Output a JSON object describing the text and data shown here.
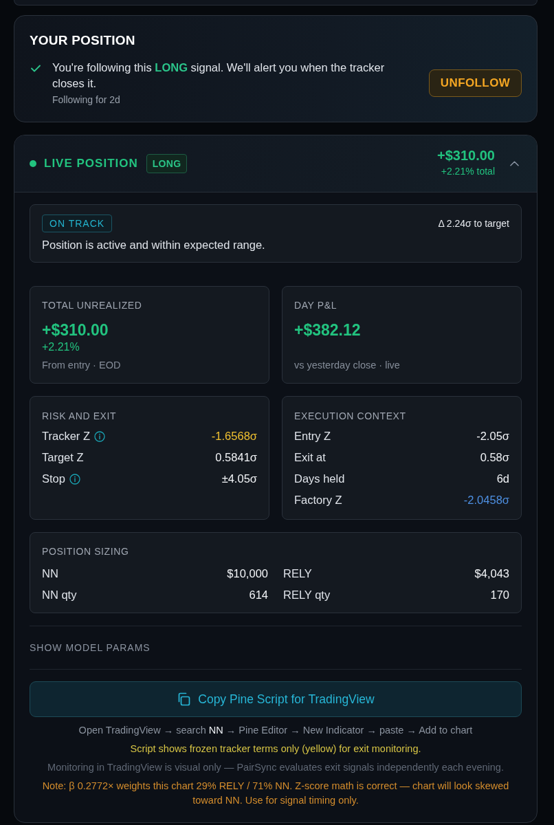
{
  "your_position": {
    "title": "YOUR POSITION",
    "following": true,
    "message": "You're following this **LONG** signal. We'll alert you when the tracker closes it.",
    "duration": "Following for 2d",
    "button": "UNFOLLOW"
  },
  "live_position": {
    "live": true,
    "title": "LIVE POSITION",
    "side": "LONG",
    "pnl": "+$310.00",
    "pnl_total": "+2.21% total",
    "expanded": true
  },
  "status": {
    "badge": "ON TRACK",
    "distance": "Δ 2.24σ to target",
    "message": "Position is active and within expected range."
  },
  "metrics": [
    {
      "label": "TOTAL UNREALIZED",
      "value": "+$310.00",
      "change": "+2.21%",
      "note": "From entry · EOD"
    },
    {
      "label": "DAY P&L",
      "value": "+$382.12",
      "note": "vs yesterday close · live"
    }
  ],
  "panels": [
    {
      "title": "RISK AND EXIT",
      "rows": [
        {
          "label": "Tracker Z",
          "info": true,
          "value": "-1.6568σ",
          "color": "#f2c230"
        },
        {
          "label": "Target Z",
          "info": false,
          "value": "0.5841σ",
          "color": "#f2f4f7"
        },
        {
          "label": "Stop",
          "info": true,
          "value": "±4.05σ",
          "color": "#f2f4f7"
        }
      ]
    },
    {
      "title": "EXECUTION CONTEXT",
      "rows": [
        {
          "label": "Entry Z",
          "info": false,
          "value": "-2.05σ",
          "color": "#f2f4f7"
        },
        {
          "label": "Exit at",
          "info": false,
          "value": "0.58σ",
          "color": "#f2f4f7"
        },
        {
          "label": "Days held",
          "info": false,
          "value": "6d",
          "color": "#f2f4f7"
        },
        {
          "label": "Factory Z",
          "info": false,
          "value": "-2.0458σ",
          "color": "#4e90e3"
        }
      ]
    }
  ],
  "position_sizing": {
    "title": "POSITION SIZING",
    "rows": [
      {
        "label": "NN",
        "value": "$10,000"
      },
      {
        "label": "RELY",
        "value": "$4,043"
      },
      {
        "label": "NN qty",
        "value": "614"
      },
      {
        "label": "RELY qty",
        "value": "170"
      }
    ]
  },
  "model_params_toggle": "SHOW MODEL PARAMS",
  "copy_button": "Copy Pine Script for TradingView",
  "notes": [
    {
      "kind": "instructions",
      "text": "Open TradingView → search **NN** → Pine Editor → New Indicator → paste → Add to chart"
    },
    {
      "kind": "highlight",
      "text": "Script shows frozen tracker terms only (yellow) for exit monitoring."
    },
    {
      "kind": "muted",
      "text": "Monitoring in TradingView is visual only — PairSync evaluates exit signals independently each evening."
    },
    {
      "kind": "warning",
      "text": "Note: β 0.2772× weights this chart 29% RELY / 71% NN. Z-score math is correct — chart will look skewed toward NN. Use for signal timing only."
    }
  ]
}
